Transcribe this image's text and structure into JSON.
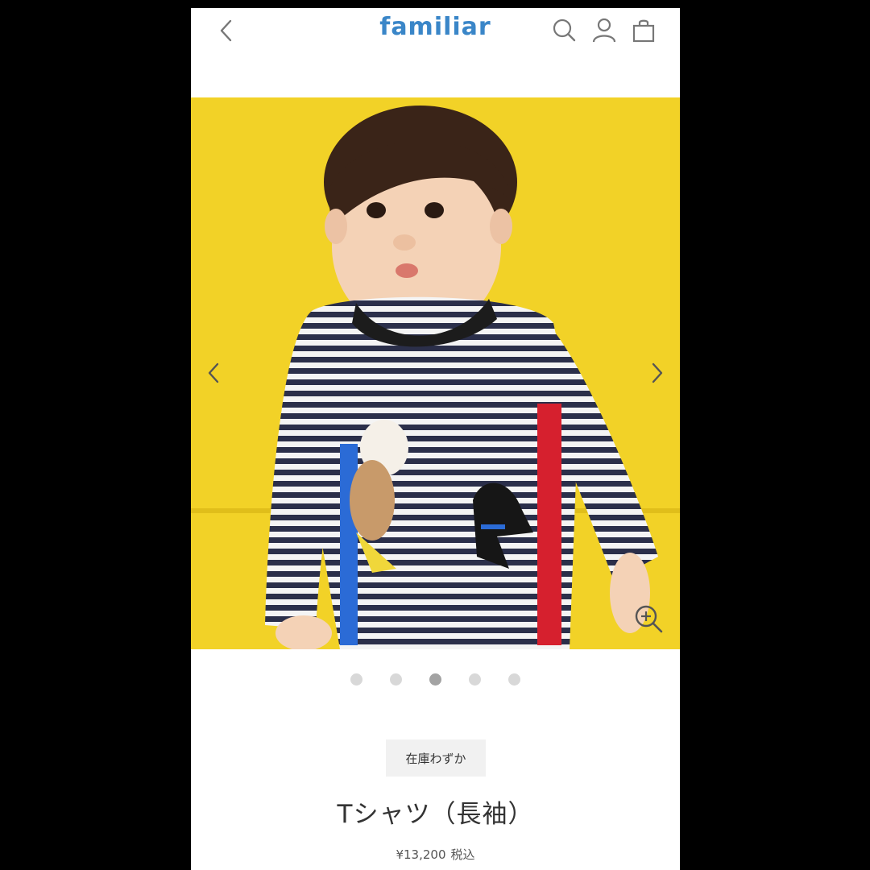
{
  "header": {
    "logo": "familiar",
    "icons": [
      "back-chevron-icon",
      "search-icon",
      "account-icon",
      "cart-icon"
    ]
  },
  "gallery": {
    "slide_count": 5,
    "active_slide": 3,
    "controls": [
      "chevron-left-icon",
      "chevron-right-icon",
      "zoom-in-icon"
    ]
  },
  "product": {
    "stock_badge": "在庫わずか",
    "title": "Tシャツ（長袖）",
    "price": "¥13,200",
    "tax_label": "税込"
  },
  "colors": {
    "logo": "#3a86c8",
    "background_yellow": "#f2d227",
    "stripe_navy": "#2b2f4a"
  }
}
